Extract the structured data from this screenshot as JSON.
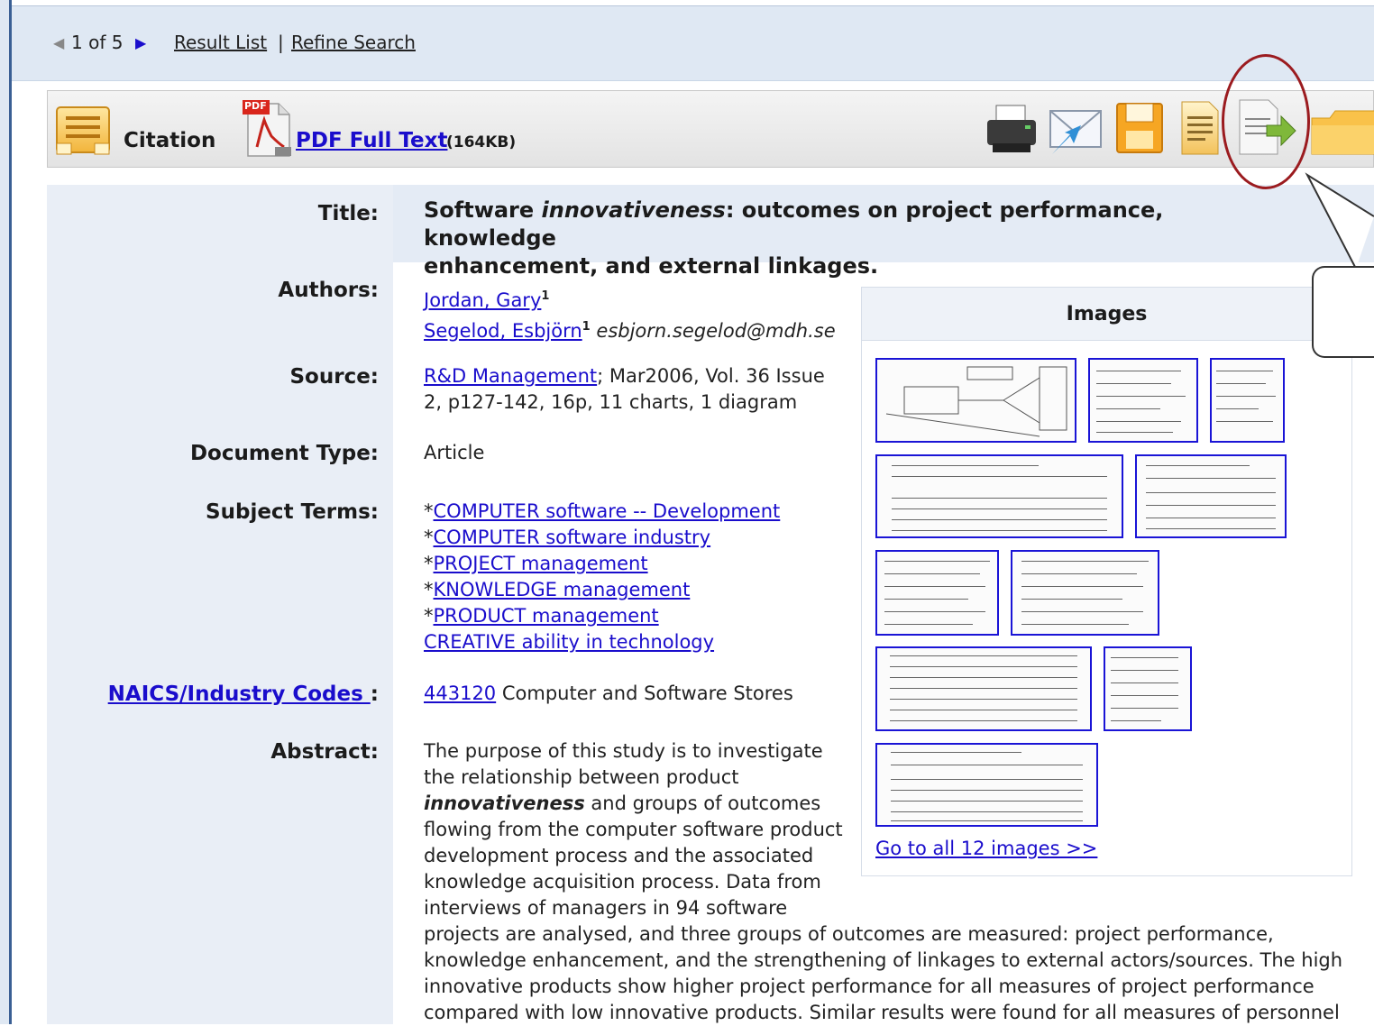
{
  "nav": {
    "record_position": "1 of 5",
    "result_list": "Result List",
    "separator": "|",
    "refine_search": "Refine Search"
  },
  "toolbar": {
    "citation": "Citation",
    "pdf_badge": "PDF",
    "pdf_full_text": "PDF Full Text",
    "pdf_size": "(164KB)",
    "actions": [
      "print-icon",
      "email-icon",
      "save-icon",
      "cite-icon",
      "export-icon",
      "folder-icon"
    ]
  },
  "record": {
    "title_label": "Title:",
    "title_prefix": "Software ",
    "title_italic": "innovativeness",
    "title_line1_rest": ": outcomes on project performance, knowledge",
    "title_line2": "enhancement, and external linkages.",
    "authors_label": "Authors:",
    "author1": "Jordan, Gary",
    "author1_sup": "1",
    "author2": "Segelod, Esbjörn",
    "author2_sup": "1",
    "author2_email": "esbjorn.segelod@mdh.se",
    "source_label": "Source:",
    "source_link": "R&D Management",
    "source_rest1": "; Mar2006, Vol. 36 Issue",
    "source_rest2": "2, p127-142, 16p, 11 charts, 1 diagram",
    "doctype_label": "Document Type:",
    "doctype": "Article",
    "subjects_label": "Subject Terms:",
    "subjects": [
      {
        "star": "*",
        "term": "COMPUTER software -- Development"
      },
      {
        "star": "*",
        "term": "COMPUTER software industry"
      },
      {
        "star": "*",
        "term": "PROJECT management"
      },
      {
        "star": "*",
        "term": "KNOWLEDGE management"
      },
      {
        "star": "*",
        "term": "PRODUCT management"
      },
      {
        "star": "",
        "term": "CREATIVE ability in technology"
      }
    ],
    "naics_label": "NAICS/Industry Codes ",
    "naics_colon": ":",
    "naics_code": "443120",
    "naics_desc": " Computer and Software Stores",
    "abstract_label": "Abstract:",
    "abstract_l1": "The purpose of this study is to investigate",
    "abstract_l2": "the relationship between product",
    "abstract_l3_italic": "innovativeness",
    "abstract_l3_rest": " and groups of outcomes",
    "abstract_l4": "flowing from the computer software product",
    "abstract_l5": "development process and the associated",
    "abstract_l6": "knowledge acquisition process. Data from",
    "abstract_l7": "interviews of managers in 94 software",
    "abstract_l8": "projects are analysed, and three groups of outcomes are measured: project performance,",
    "abstract_l9": "knowledge enhancement, and the strengthening of linkages to external actors/sources. The high",
    "abstract_l10": "innovative products show higher project performance for all measures of project performance",
    "abstract_l11": "compared with low innovative products. Similar results were found for all measures of personnel"
  },
  "images": {
    "heading": "Images",
    "go_all": "Go to all 12 images >>"
  },
  "colors": {
    "link": "#1a0dcc",
    "panel": "#e9eef6",
    "callout": "#9b1b1f"
  }
}
